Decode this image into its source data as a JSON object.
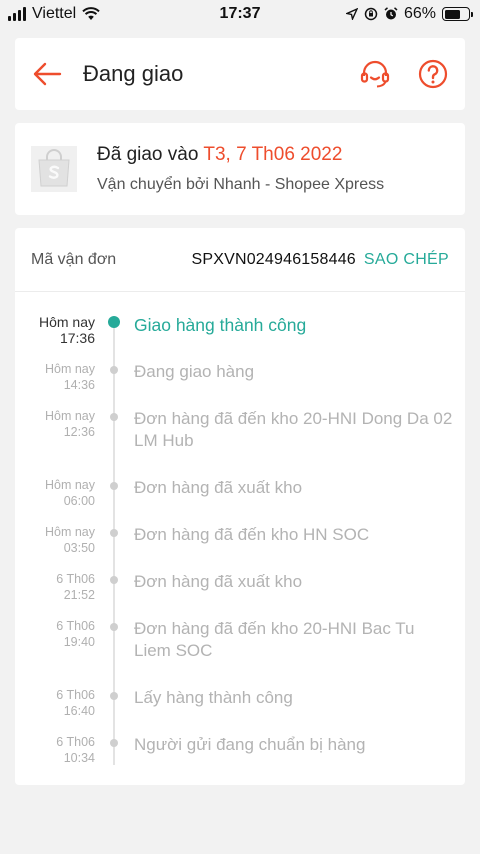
{
  "status_bar": {
    "carrier": "Viettel",
    "time": "17:37",
    "battery": "66%",
    "battery_level": 0.66
  },
  "header": {
    "title": "Đang giao",
    "back_icon": "arrow-left-icon",
    "support_icon": "headset-icon",
    "help_icon": "question-circle-icon",
    "accent_color": "#ee4d2d"
  },
  "delivery": {
    "prefix": "Đã giao vào ",
    "date": "T3, 7 Th06 2022",
    "carrier_text": "Vận chuyển bởi Nhanh - Shopee Xpress"
  },
  "tracking": {
    "label": "Mã vận đơn",
    "code": "SPXVN024946158446",
    "copy_label": "SAO CHÉP",
    "accent_color": "#26aa99",
    "events": [
      {
        "date": "Hôm nay",
        "time": "17:36",
        "desc": "Giao hàng thành công",
        "active": true
      },
      {
        "date": "Hôm nay",
        "time": "14:36",
        "desc": "Đang giao hàng",
        "active": false
      },
      {
        "date": "Hôm nay",
        "time": "12:36",
        "desc": "Đơn hàng đã đến kho 20-HNI Dong Da 02 LM Hub",
        "active": false
      },
      {
        "date": "Hôm nay",
        "time": "06:00",
        "desc": "Đơn hàng đã xuất kho",
        "active": false
      },
      {
        "date": "Hôm nay",
        "time": "03:50",
        "desc": "Đơn hàng đã đến kho HN SOC",
        "active": false
      },
      {
        "date": "6 Th06",
        "time": "21:52",
        "desc": "Đơn hàng đã xuất kho",
        "active": false
      },
      {
        "date": "6 Th06",
        "time": "19:40",
        "desc": "Đơn hàng đã đến kho 20-HNI Bac Tu Liem SOC",
        "active": false
      },
      {
        "date": "6 Th06",
        "time": "16:40",
        "desc": "Lấy hàng thành công",
        "active": false
      },
      {
        "date": "6 Th06",
        "time": "10:34",
        "desc": "Người gửi đang chuẩn bị hàng",
        "active": false
      }
    ]
  }
}
